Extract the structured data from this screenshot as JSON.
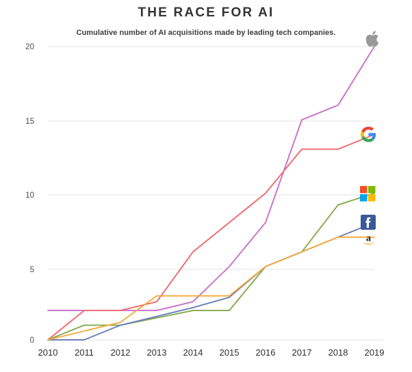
{
  "chart_data": {
    "type": "line",
    "title": "THE RACE FOR AI",
    "subtitle": "Cumulative number of AI acquisitions made by leading tech companies.",
    "xlabel": "",
    "ylabel": "",
    "x": [
      2010,
      2011,
      2012,
      2013,
      2014,
      2015,
      2016,
      2017,
      2018,
      2019
    ],
    "categories": [
      "2010",
      "2011",
      "2012",
      "2013",
      "2014",
      "2015",
      "2016",
      "2017",
      "2018",
      "2019"
    ],
    "xlim": [
      2010,
      2019
    ],
    "ylim": [
      0,
      20
    ],
    "yticks": [
      0,
      5,
      10,
      15,
      20
    ],
    "ytick_labels": [
      "0",
      "5",
      "10",
      "15",
      "20"
    ],
    "grid": "horizontal",
    "legend": "inline-logos-right",
    "series": [
      {
        "name": "Apple",
        "logo": "apple-logo",
        "color": "#c86fc9",
        "end_value": 20,
        "values": [
          2,
          2,
          2,
          2,
          2.6,
          5,
          8,
          15,
          16,
          20
        ]
      },
      {
        "name": "Google",
        "logo": "google-logo",
        "color": "#f2686f",
        "end_value": 14,
        "values": [
          0,
          2,
          2,
          2.6,
          6,
          8,
          10,
          13,
          13,
          14
        ]
      },
      {
        "name": "Microsoft",
        "logo": "microsoft-logo",
        "color": "#84a84b",
        "end_value": 10,
        "values": [
          0,
          1,
          1,
          1.5,
          2,
          2,
          5,
          6,
          9.2,
          10
        ]
      },
      {
        "name": "Facebook",
        "logo": "facebook-logo",
        "color": "#6b7fbd",
        "end_value": 8,
        "values": [
          0,
          0,
          1,
          1.6,
          2.2,
          2.9,
          5,
          6,
          7,
          8
        ]
      },
      {
        "name": "Amazon",
        "logo": "amazon-logo",
        "color": "#f5a93a",
        "end_value": 7,
        "values": [
          0,
          0.6,
          1.2,
          3,
          3,
          3,
          5,
          6,
          7,
          7
        ]
      }
    ]
  },
  "axis": {
    "y_labels": [
      "20",
      "15",
      "10",
      "5",
      "0"
    ],
    "x_labels": [
      "2010",
      "2011",
      "2012",
      "2013",
      "2014",
      "2015",
      "2016",
      "2017",
      "2018",
      "2019"
    ]
  },
  "logos": {
    "apple": "apple-logo",
    "google": "google-logo",
    "microsoft": "microsoft-logo",
    "facebook": "facebook-logo",
    "amazon": "amazon-logo"
  },
  "colors": {
    "apple": "#c86fc9",
    "google": "#f2686f",
    "microsoft": "#84a84b",
    "facebook": "#6b7fbd",
    "amazon": "#f5a93a",
    "grid": "#e6e6e6",
    "text": "#333333"
  }
}
